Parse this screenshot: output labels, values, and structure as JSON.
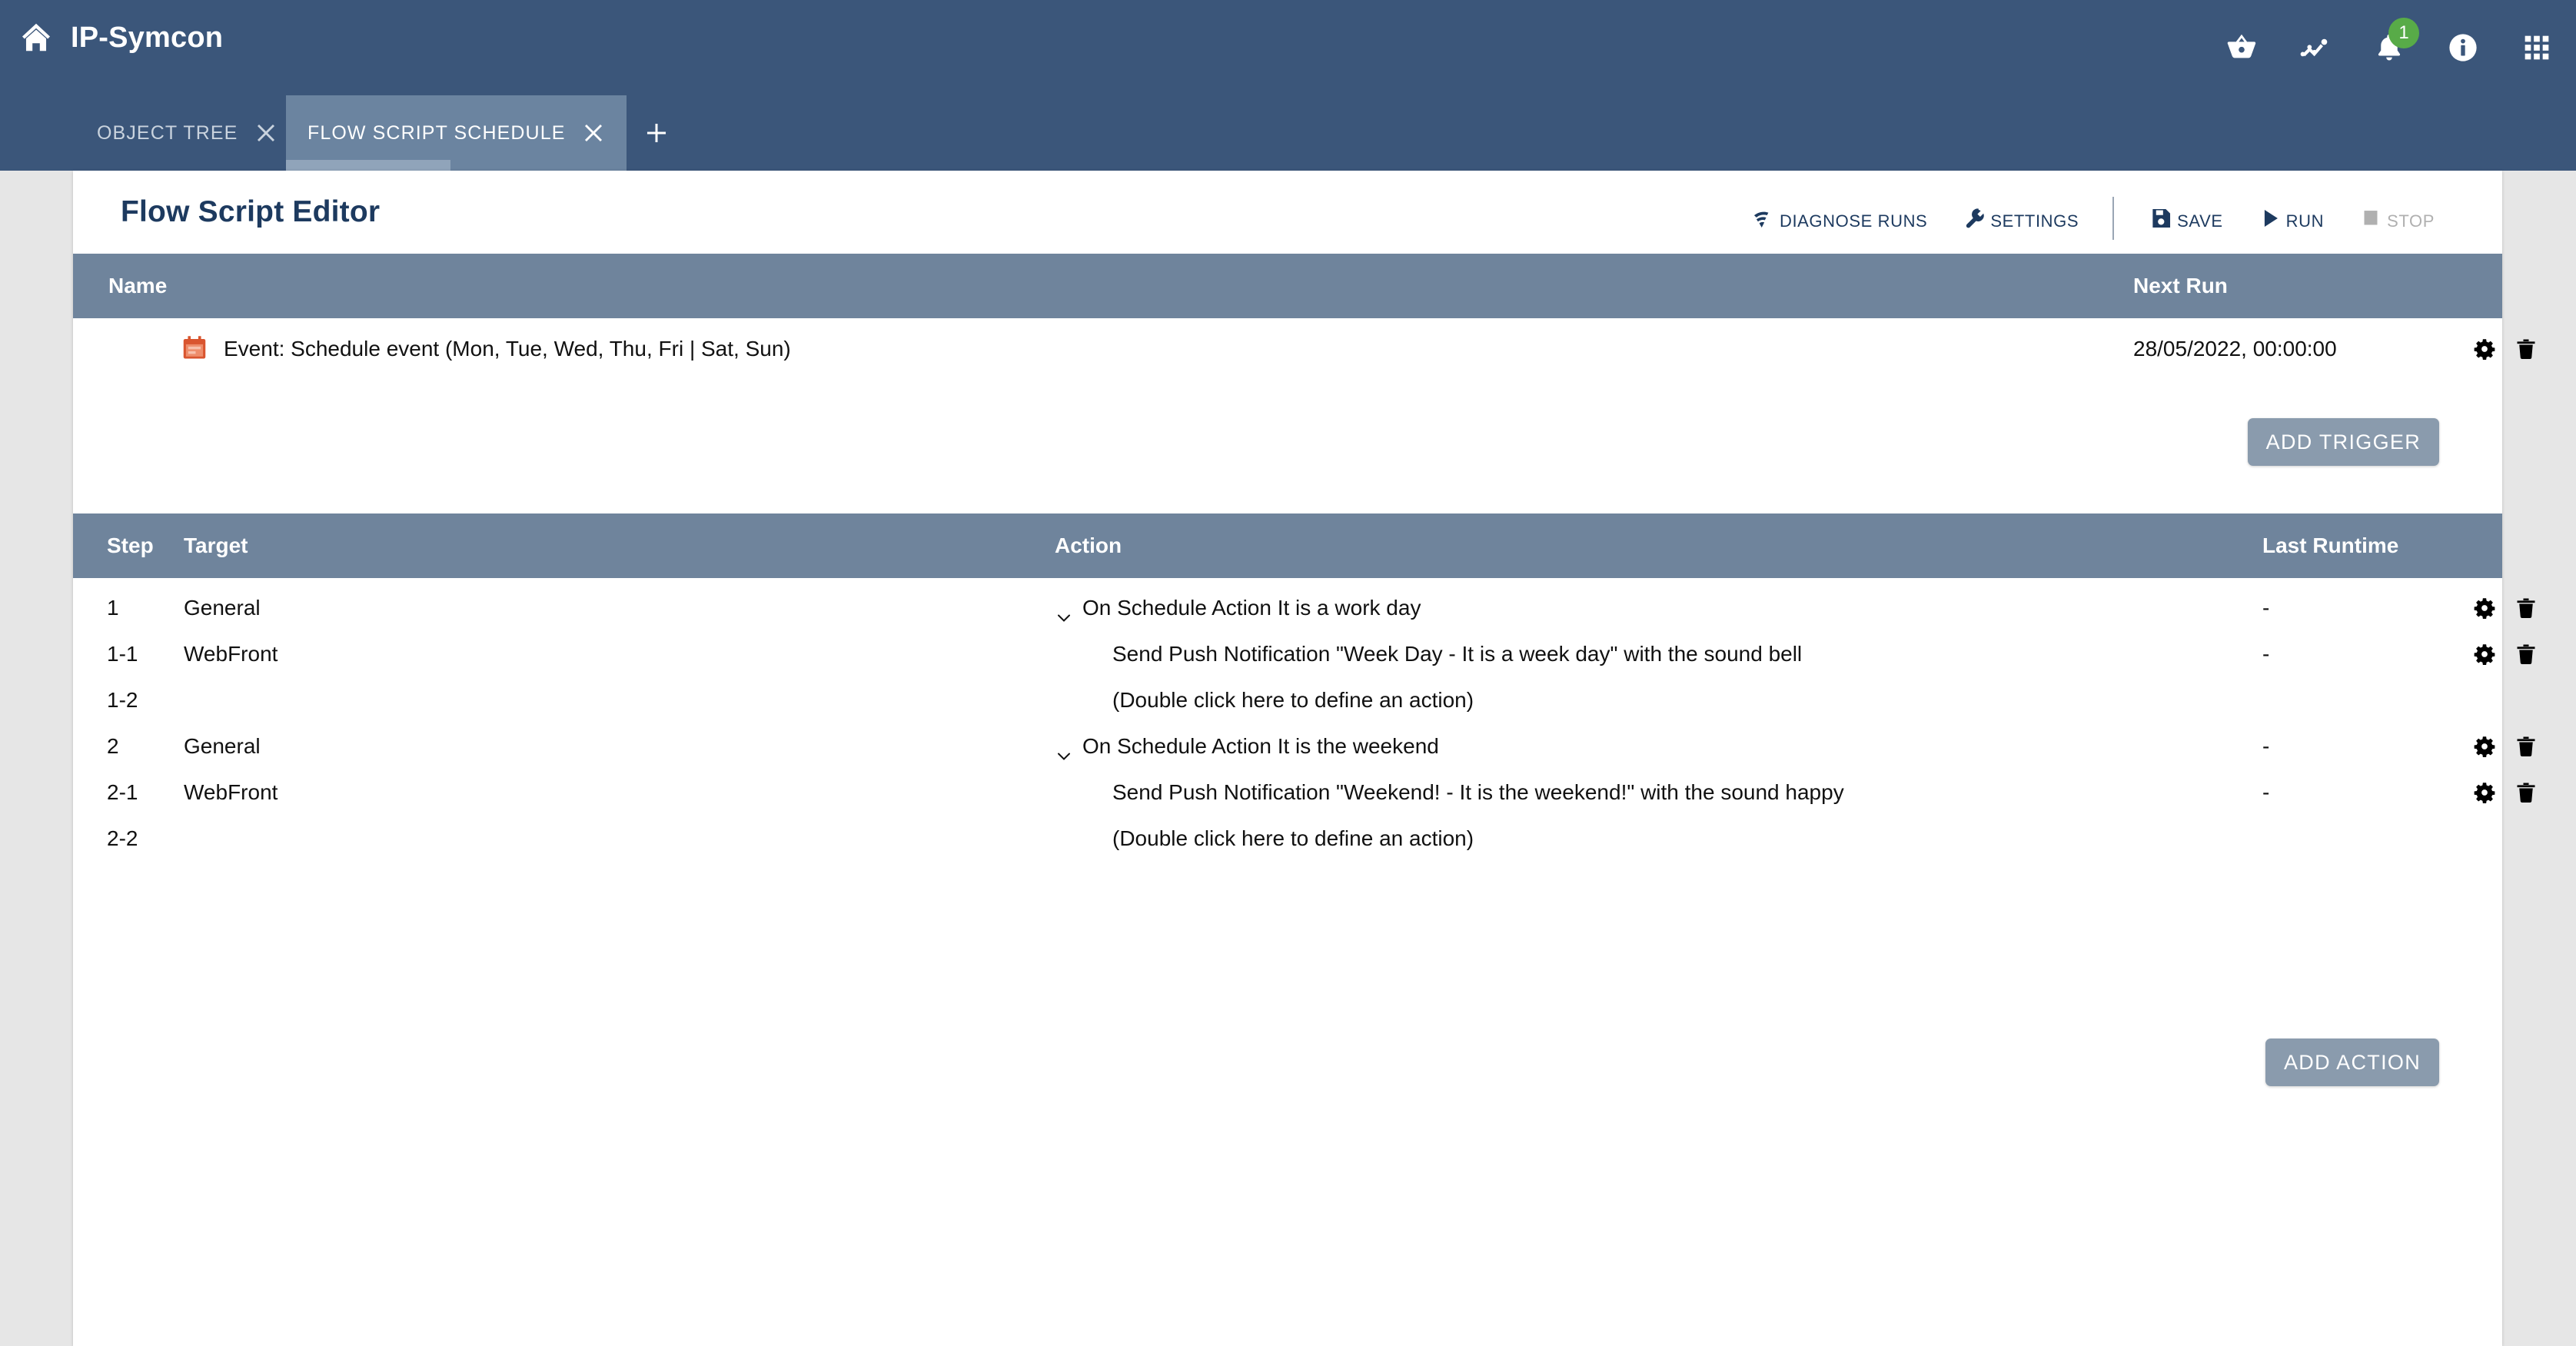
{
  "app": {
    "brand": "IP-Symcon",
    "home_icon": "home-icon",
    "icons": [
      {
        "name": "basket-icon"
      },
      {
        "name": "chart-line-icon"
      },
      {
        "name": "bell-icon",
        "badge": "1"
      },
      {
        "name": "info-icon"
      },
      {
        "name": "apps-grid-icon"
      }
    ],
    "badge_color": "#58ab48",
    "header_color": "#3b567a"
  },
  "tabs": {
    "items": [
      {
        "label": "OBJECT TREE",
        "active": false
      },
      {
        "label": "FLOW SCRIPT SCHEDULE",
        "active": true
      }
    ],
    "add_label": "+",
    "close_icon": "close-icon",
    "add_icon": "plus-icon"
  },
  "editor": {
    "title": "Flow Script Editor",
    "toolbar": [
      {
        "label": "DIAGNOSE RUNS",
        "icon": "diagnose-icon",
        "disabled": false
      },
      {
        "label": "SETTINGS",
        "icon": "wrench-icon",
        "disabled": false
      },
      {
        "label": "SAVE",
        "icon": "save-icon",
        "disabled": false
      },
      {
        "label": "RUN",
        "icon": "play-icon",
        "disabled": false
      },
      {
        "label": "STOP",
        "icon": "stop-icon",
        "disabled": true
      }
    ]
  },
  "triggers": {
    "columns": {
      "name": "Name",
      "next_run": "Next Run"
    },
    "rows": [
      {
        "icon": "calendar-icon",
        "name": "Event: Schedule event (Mon, Tue, Wed, Thu, Fri | Sat, Sun)",
        "next_run": "28/05/2022, 00:00:00",
        "settings_icon": "gear-icon",
        "delete_icon": "trash-icon"
      }
    ],
    "add_button": "ADD TRIGGER"
  },
  "actions": {
    "columns": {
      "step": "Step",
      "target": "Target",
      "action": "Action",
      "last_runtime": "Last Runtime"
    },
    "rows": [
      {
        "step": "1",
        "target": "General",
        "action": "On Schedule Action It is a work day",
        "chevron": true,
        "indent": 0,
        "last_runtime": "-",
        "has_controls": true
      },
      {
        "step": "1-1",
        "target": "WebFront",
        "action": "Send Push Notification \"Week Day - It is a week day\" with the sound bell",
        "chevron": false,
        "indent": 1,
        "last_runtime": "-",
        "has_controls": true
      },
      {
        "step": "1-2",
        "target": "",
        "action": "(Double click here to define an action)",
        "chevron": false,
        "indent": 1,
        "last_runtime": "",
        "has_controls": false
      },
      {
        "step": "2",
        "target": "General",
        "action": "On Schedule Action It is the weekend",
        "chevron": true,
        "indent": 0,
        "last_runtime": "-",
        "has_controls": true
      },
      {
        "step": "2-1",
        "target": "WebFront",
        "action": "Send Push Notification \"Weekend! - It is the weekend!\" with the sound happy",
        "chevron": false,
        "indent": 1,
        "last_runtime": "-",
        "has_controls": true
      },
      {
        "step": "2-2",
        "target": "",
        "action": "(Double click here to define an action)",
        "chevron": false,
        "indent": 1,
        "last_runtime": "",
        "has_controls": false
      }
    ],
    "add_button": "ADD ACTION"
  },
  "colors": {
    "header": "#3b567a",
    "table_header": "#6f849c",
    "button": "#8a9bad",
    "title": "#1d3a5f",
    "calendar_icon": "#d9552f",
    "badge": "#58ab48"
  }
}
